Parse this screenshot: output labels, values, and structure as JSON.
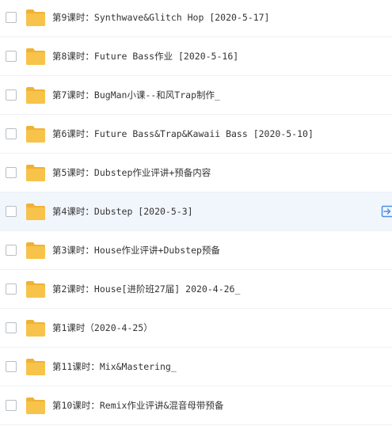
{
  "colors": {
    "folder_body": "#f7c34a",
    "folder_tab": "#f0b235",
    "hover_row": "#f1f6fd",
    "text": "#333333",
    "action_icon": "#4a8ee6"
  },
  "files": [
    {
      "name": "第9课时：Synthwave&Glitch Hop [2020-5-17]",
      "icon": "folder-icon"
    },
    {
      "name": "第8课时：Future Bass作业 [2020-5-16]",
      "icon": "folder-icon"
    },
    {
      "name": "第7课时：BugMan小课--和风Trap制作_",
      "icon": "folder-icon"
    },
    {
      "name": "第6课时：Future Bass&Trap&Kawaii Bass [2020-5-10]",
      "icon": "folder-icon"
    },
    {
      "name": "第5课时：Dubstep作业评讲+预备内容",
      "icon": "folder-icon"
    },
    {
      "name": "第4课时：Dubstep [2020-5-3]",
      "icon": "folder-icon",
      "hovered": true
    },
    {
      "name": "第3课时：House作业评讲+Dubstep预备",
      "icon": "folder-icon"
    },
    {
      "name": "第2课时：House[进阶班27届] 2020-4-26_",
      "icon": "folder-icon"
    },
    {
      "name": "第1课时（2020-4-25）",
      "icon": "folder-icon"
    },
    {
      "name": "第11课时：Mix&Mastering_",
      "icon": "folder-icon"
    },
    {
      "name": "第10课时：Remix作业评讲&混音母带预备",
      "icon": "folder-icon"
    }
  ]
}
